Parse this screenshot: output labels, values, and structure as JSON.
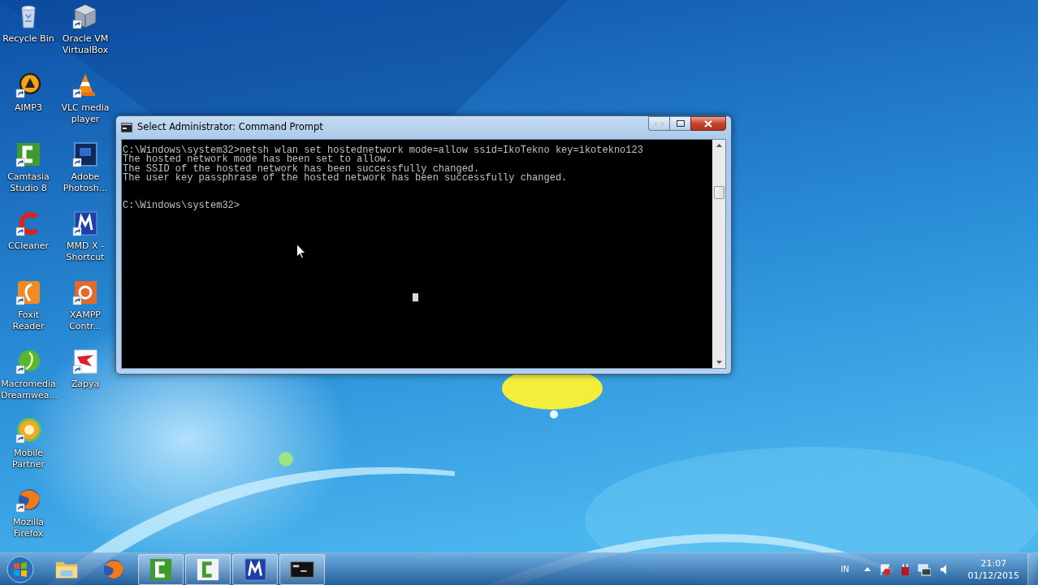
{
  "desktop_icons": [
    {
      "label": "Recycle Bin"
    },
    {
      "label": "Oracle VM VirtualBox"
    },
    {
      "label": "AIMP3"
    },
    {
      "label": "VLC media player"
    },
    {
      "label": "Camtasia Studio 8"
    },
    {
      "label": "Adobe Photosh..."
    },
    {
      "label": "CCleaner"
    },
    {
      "label": "MMD X - Shortcut"
    },
    {
      "label": "Foxit Reader"
    },
    {
      "label": "XAMPP Contr..."
    },
    {
      "label": "Macromedia Dreamwea..."
    },
    {
      "label": "Zapya"
    },
    {
      "label": "Mobile Partner"
    },
    {
      "label": "Mozilla Firefox"
    }
  ],
  "window": {
    "title": "Select Administrator: Command Prompt",
    "console": {
      "output": [
        "C:\\Windows\\system32>netsh wlan set hostednetwork mode=allow ssid=IkoTekno key=ikotekno123",
        "The hosted network mode has been set to allow.",
        "The SSID of the hosted network has been successfully changed.",
        "The user key passphrase of the hosted network has been successfully changed."
      ],
      "prompt": "C:\\Windows\\system32>"
    }
  },
  "taskbar": {
    "items": [
      {
        "running": false
      },
      {
        "running": false
      },
      {
        "running": true
      },
      {
        "running": true
      },
      {
        "running": true
      },
      {
        "running": true
      }
    ],
    "language": "IN",
    "time": "21:07",
    "date": "01/12/2015"
  }
}
